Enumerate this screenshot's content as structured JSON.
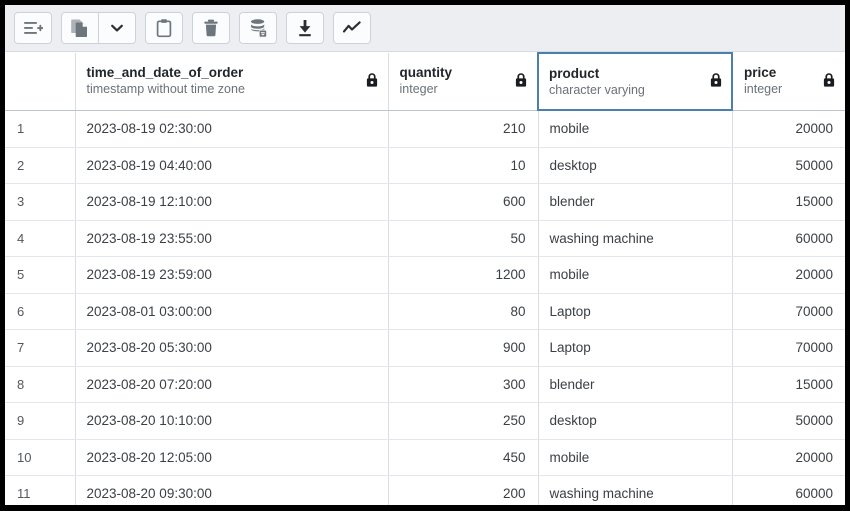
{
  "window": {
    "border_color": "#000000",
    "background": "#ffffff"
  },
  "toolbar": {
    "background": "#eceef1",
    "groups": [
      {
        "name": "insert-group",
        "buttons": [
          {
            "name": "add-row-button",
            "icon": "add-row-icon",
            "label": "Add row"
          }
        ]
      },
      {
        "name": "copy-group",
        "buttons": [
          {
            "name": "copy-button",
            "icon": "copy-icon",
            "label": "Copy"
          },
          {
            "name": "copy-options-button",
            "icon": "chevron-down-icon",
            "label": "Copy options"
          }
        ]
      },
      {
        "name": "paste-group",
        "buttons": [
          {
            "name": "paste-button",
            "icon": "clipboard-icon",
            "label": "Paste"
          }
        ]
      },
      {
        "name": "delete-group",
        "buttons": [
          {
            "name": "delete-button",
            "icon": "trash-icon",
            "label": "Delete"
          }
        ]
      },
      {
        "name": "filter-group",
        "buttons": [
          {
            "name": "filter-data-button",
            "icon": "database-filter-icon",
            "label": "Filter data"
          }
        ]
      },
      {
        "name": "download-group",
        "buttons": [
          {
            "name": "download-button",
            "icon": "download-icon",
            "label": "Download"
          }
        ]
      },
      {
        "name": "chart-group",
        "buttons": [
          {
            "name": "graph-visualiser-button",
            "icon": "line-chart-icon",
            "label": "Graph visualiser"
          }
        ]
      }
    ]
  },
  "grid": {
    "selected_column": "product",
    "selection_color": "#4a80ab",
    "columns": [
      {
        "name": "",
        "type": "",
        "locked": false,
        "align": "left",
        "selected": false
      },
      {
        "name": "time_and_date_of_order",
        "type": "timestamp without time zone",
        "locked": true,
        "align": "left",
        "selected": false
      },
      {
        "name": "quantity",
        "type": "integer",
        "locked": true,
        "align": "right",
        "selected": false
      },
      {
        "name": "product",
        "type": "character varying",
        "locked": true,
        "align": "left",
        "selected": true
      },
      {
        "name": "price",
        "type": "integer",
        "locked": true,
        "align": "right",
        "selected": false
      }
    ],
    "rows": [
      {
        "num": "1",
        "time_and_date_of_order": "2023-08-19 02:30:00",
        "quantity": "210",
        "product": "mobile",
        "price": "20000"
      },
      {
        "num": "2",
        "time_and_date_of_order": "2023-08-19 04:40:00",
        "quantity": "10",
        "product": "desktop",
        "price": "50000"
      },
      {
        "num": "3",
        "time_and_date_of_order": "2023-08-19 12:10:00",
        "quantity": "600",
        "product": "blender",
        "price": "15000"
      },
      {
        "num": "4",
        "time_and_date_of_order": "2023-08-19 23:55:00",
        "quantity": "50",
        "product": "washing machine",
        "price": "60000"
      },
      {
        "num": "5",
        "time_and_date_of_order": "2023-08-19 23:59:00",
        "quantity": "1200",
        "product": "mobile",
        "price": "20000"
      },
      {
        "num": "6",
        "time_and_date_of_order": "2023-08-01 03:00:00",
        "quantity": "80",
        "product": "Laptop",
        "price": "70000"
      },
      {
        "num": "7",
        "time_and_date_of_order": "2023-08-20 05:30:00",
        "quantity": "900",
        "product": "Laptop",
        "price": "70000"
      },
      {
        "num": "8",
        "time_and_date_of_order": "2023-08-20 07:20:00",
        "quantity": "300",
        "product": "blender",
        "price": "15000"
      },
      {
        "num": "9",
        "time_and_date_of_order": "2023-08-20 10:10:00",
        "quantity": "250",
        "product": "desktop",
        "price": "50000"
      },
      {
        "num": "10",
        "time_and_date_of_order": "2023-08-20 12:05:00",
        "quantity": "450",
        "product": "mobile",
        "price": "20000"
      },
      {
        "num": "11",
        "time_and_date_of_order": "2023-08-20 09:30:00",
        "quantity": "200",
        "product": "washing machine",
        "price": "60000"
      }
    ]
  }
}
